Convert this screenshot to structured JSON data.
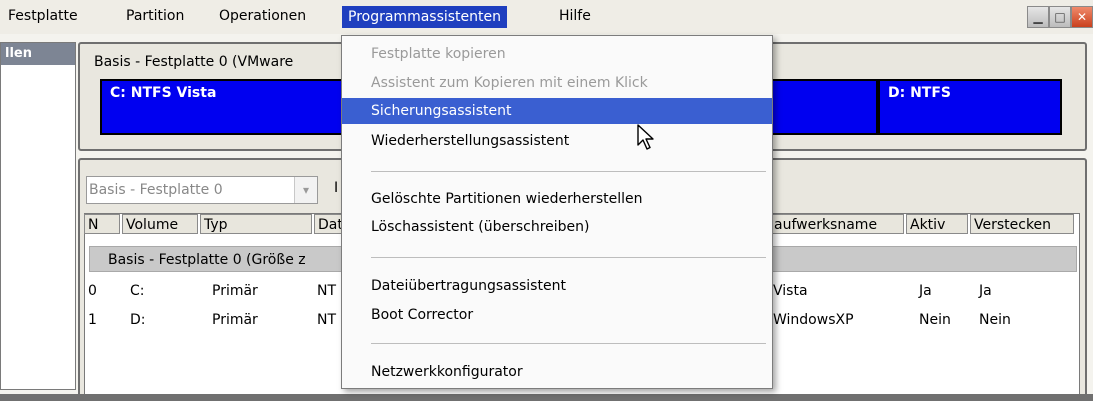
{
  "menubar": {
    "items": [
      "Festplatte",
      "Partition",
      "Operationen",
      "Programmassistenten",
      "Hilfe"
    ],
    "active": "Programmassistenten"
  },
  "window": {
    "min_label": "▁",
    "max_label": "□",
    "close_label": "✕"
  },
  "left_panel": {
    "header": "llen"
  },
  "disk_map": {
    "title": "Basis - Festplatte 0 (VMware",
    "partitions": [
      "C: NTFS Vista",
      "D: NTFS"
    ],
    "partition_color": "#0000f0"
  },
  "disk_list": {
    "selector_value": "Basis - Festplatte 0",
    "label_fragment": "I",
    "columns": [
      "N",
      "Volume",
      "Typ",
      "Dat",
      "aufwerksname",
      "Aktiv",
      "Verstecken"
    ],
    "group_label": "Basis - Festplatte 0 (Größe z",
    "rows": [
      {
        "n": "0",
        "volume": "C:",
        "typ": "Primär",
        "dat": "NT",
        "name": "Vista",
        "aktiv": "Ja",
        "versteckt": "Ja"
      },
      {
        "n": "1",
        "volume": "D:",
        "typ": "Primär",
        "dat": "NT",
        "name": "WindowsXP",
        "aktiv": "Nein",
        "versteckt": "Nein"
      }
    ]
  },
  "dropdown": {
    "items": [
      {
        "label": "Festplatte kopieren",
        "state": "disabled"
      },
      {
        "label": "Assistent zum Kopieren mit einem Klick",
        "state": "disabled"
      },
      {
        "label": "Sicherungsassistent",
        "state": "highlighted"
      },
      {
        "label": "Wiederherstellungsassistent",
        "state": "normal"
      },
      {
        "label": "Gelöschte Partitionen wiederherstellen",
        "state": "normal"
      },
      {
        "label": "Löschassistent (überschreiben)",
        "state": "normal"
      },
      {
        "label": "Dateiübertragungsassistent",
        "state": "normal"
      },
      {
        "label": "Boot Corrector",
        "state": "normal"
      },
      {
        "label": "Netzwerkkonfigurator",
        "state": "normal"
      }
    ],
    "highlight_color": "#3a5fd1"
  }
}
